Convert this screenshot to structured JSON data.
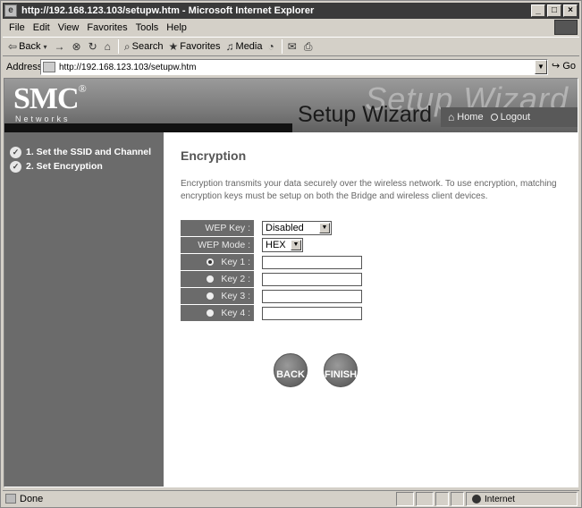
{
  "window": {
    "title": "http://192.168.123.103/setupw.htm - Microsoft Internet Explorer",
    "controls": {
      "minimize": "_",
      "maximize": "□",
      "close": "×"
    }
  },
  "menubar": {
    "items": [
      "File",
      "Edit",
      "View",
      "Favorites",
      "Tools",
      "Help"
    ]
  },
  "toolbar": {
    "back": "Back",
    "forward": "→",
    "stop": "⊗",
    "refresh": "↻",
    "home": "⌂",
    "search": "Search",
    "favorites": "Favorites",
    "media": "Media",
    "history": "◔",
    "mail": "✉",
    "print": "⎙"
  },
  "addressbar": {
    "label": "Address",
    "url": "http://192.168.123.103/setupw.htm",
    "go": "Go"
  },
  "header": {
    "logo": "SMC",
    "logo_mark": "®",
    "tagline": "Networks",
    "background_title": "Setup Wizard",
    "title": "Setup Wizard",
    "nav": {
      "home": "Home",
      "logout": "Logout"
    }
  },
  "sidebar": {
    "steps": [
      {
        "label": "1. Set the SSID and Channel",
        "icon": "check-circle-icon"
      },
      {
        "label": "2. Set Encryption",
        "icon": "check-circle-icon"
      }
    ]
  },
  "main": {
    "heading": "Encryption",
    "description": "Encryption transmits your data securely over the wireless network. To use encryption, matching encryption keys must be setup on both the Bridge and wireless client devices.",
    "form": {
      "wep_key": {
        "label": "WEP Key :",
        "value": "Disabled"
      },
      "wep_mode": {
        "label": "WEP Mode :",
        "value": "HEX"
      },
      "keys": [
        {
          "label": "Key 1 :",
          "value": "",
          "selected": true
        },
        {
          "label": "Key 2 :",
          "value": "",
          "selected": false
        },
        {
          "label": "Key 3 :",
          "value": "",
          "selected": false
        },
        {
          "label": "Key 4 :",
          "value": "",
          "selected": false
        }
      ]
    },
    "buttons": {
      "back": "BACK",
      "finish": "FINISH"
    }
  },
  "statusbar": {
    "text": "Done",
    "zone": "Internet"
  },
  "colors": {
    "titlebar": "#3a3a3a",
    "sidebar": "#6b6b6b",
    "label_cell": "#6b6b6b",
    "header_bar": "#595959"
  }
}
